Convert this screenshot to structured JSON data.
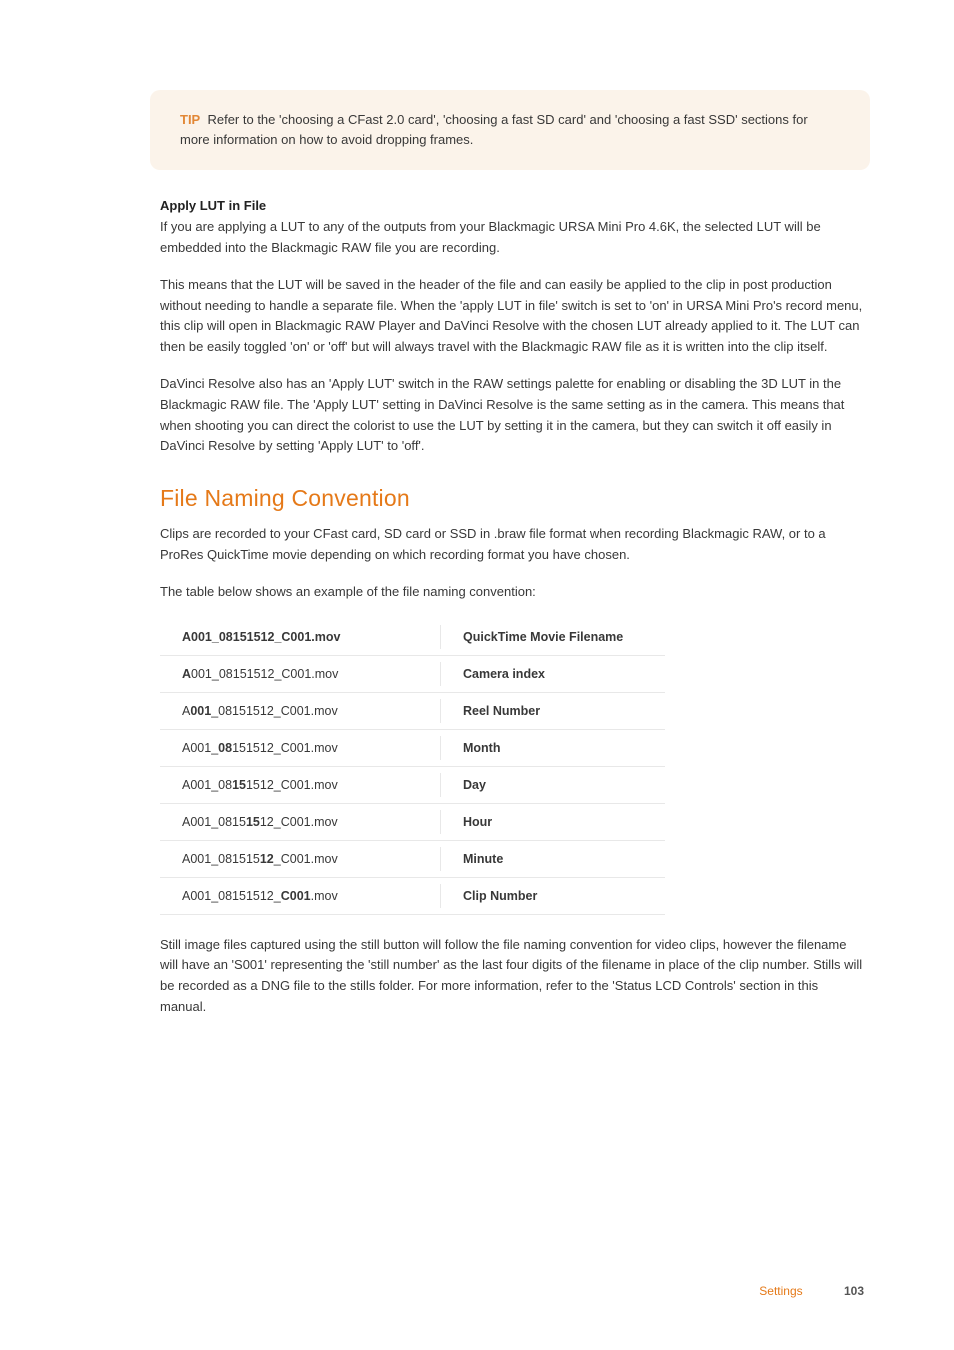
{
  "tip": {
    "label": "TIP",
    "text": "Refer to the 'choosing a CFast 2.0 card', 'choosing a fast SD card' and 'choosing a fast SSD' sections for more information on how to avoid dropping frames."
  },
  "apply_lut": {
    "heading": "Apply LUT in File",
    "p1": "If you are applying a LUT to any of the outputs from your Blackmagic URSA Mini Pro 4.6K, the selected LUT will be embedded into the Blackmagic RAW file you are recording.",
    "p2": "This means that the LUT will be saved in the header of the file and can easily be applied to the clip in post production without needing to handle a separate file. When the 'apply LUT in file' switch is set to 'on' in URSA Mini Pro's record menu, this clip will open in Blackmagic RAW Player and DaVinci Resolve with the chosen LUT already applied to it. The LUT can then be easily toggled 'on' or 'off' but will always travel with the Blackmagic RAW file as it is written into the clip itself.",
    "p3": "DaVinci Resolve also has an 'Apply LUT' switch in the RAW settings palette for enabling or disabling the 3D LUT in the Blackmagic RAW file. The 'Apply LUT' setting in DaVinci Resolve is the same setting as in the camera. This means that when shooting you can direct the colorist to use the LUT by setting it in the camera, but they can switch it off easily in DaVinci Resolve by setting 'Apply LUT' to 'off'."
  },
  "file_naming": {
    "heading": "File Naming Convention",
    "intro": "Clips are recorded to your CFast card, SD card or SSD in .braw file format when recording Blackmagic RAW, or to a ProRes QuickTime movie depending on which recording format you have chosen.",
    "table_lead": "The table below shows an example of the file naming convention:",
    "rows": [
      {
        "b1": "A001_08151512_C001.mov",
        "m1": "",
        "a1": "",
        "right": "QuickTime Movie Filename"
      },
      {
        "b1": "A",
        "m1": "001_08151512_C001.mov",
        "a1": "",
        "right": "Camera index"
      },
      {
        "b1": "",
        "m1": "A",
        "a1": "",
        "bold2": "001",
        "tail": "_08151512_C001.mov",
        "right": "Reel Number"
      },
      {
        "b1": "",
        "m1": "A001_",
        "a1": "",
        "bold2": "08",
        "tail": "151512_C001.mov",
        "right": "Month"
      },
      {
        "b1": "",
        "m1": "A001_08",
        "a1": "",
        "bold2": "15",
        "tail": "1512_C001.mov",
        "right": "Day"
      },
      {
        "b1": "",
        "m1": "A001_0815",
        "a1": "",
        "bold2": "15",
        "tail": "12_C001.mov",
        "right": "Hour"
      },
      {
        "b1": "",
        "m1": "A001_081515",
        "a1": "",
        "bold2": "12",
        "tail": "_C001.mov",
        "right": "Minute"
      },
      {
        "b1": "",
        "m1": "A001_08151512_",
        "a1": "",
        "bold2": "C001",
        "tail": ".mov",
        "right": "Clip Number"
      }
    ],
    "outro": "Still image files captured using the still button will follow the file naming convention for video clips, however the filename will have an 'S001' representing the 'still number' as the last four digits of the filename in place of the clip number. Stills will be recorded as a DNG file to the stills folder. For more information, refer to the 'Status LCD Controls' section in this manual."
  },
  "footer": {
    "section": "Settings",
    "page": "103"
  }
}
